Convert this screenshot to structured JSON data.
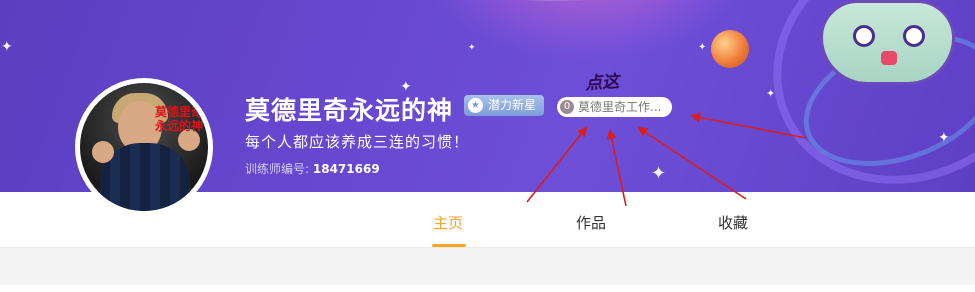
{
  "profile": {
    "username": "莫德里奇永远的神",
    "badge_label": "潜力新星",
    "tag_number": "0",
    "tag_label": "莫德里奇工作...",
    "signature": "每个人都应该养成三连的习惯！",
    "trainer_label": "训练师编号:",
    "trainer_id": "18471669",
    "avatar_sticker": "莫德里奇永远的神"
  },
  "annotation": {
    "handwriting": "点这"
  },
  "tabs": [
    {
      "label": "主页",
      "active": true
    },
    {
      "label": "作品",
      "active": false
    },
    {
      "label": "收藏",
      "active": false
    }
  ],
  "colors": {
    "banner": "#6747cf",
    "accent": "#f5a623",
    "arrow": "#d81e1e",
    "badge": "#7c9cd8"
  }
}
